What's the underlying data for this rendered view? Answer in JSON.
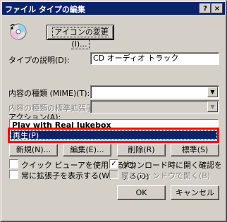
{
  "window": {
    "title": "ファイル タイプの編集",
    "help_label": "?",
    "close_label": "×"
  },
  "icon_button": {
    "label": "アイコンの変更(I)..."
  },
  "description": {
    "label": "タイプの説明(D):",
    "value": "CD オーディオ トラック"
  },
  "content_type": {
    "label": "内容の種類 (MIME)(T):",
    "value": ""
  },
  "default_extension": {
    "label": "内容の種類の標準拡張子(X):",
    "value": ""
  },
  "actions": {
    "label": "アクション(A):",
    "items": [
      "Play with Real Jukebox",
      "再生(P)"
    ]
  },
  "buttons": {
    "new": "新規(N)...",
    "edit": "編集(E)...",
    "remove": "削除(R)",
    "default": "標準(S)",
    "ok": "OK",
    "cancel": "キャンセル"
  },
  "options": {
    "quick_view": {
      "label": "クイック ビューアを使用する(Q)",
      "checked": false
    },
    "confirm_open": {
      "label": "ダウンロード時に開く確認をする(O)",
      "checked": true
    },
    "always_show_ext": {
      "label": "常に拡張子を表示する(W)",
      "checked": false
    },
    "browse_same_window": {
      "label": "同じウィンドウで開く(B)",
      "checked": false
    }
  },
  "colors": {
    "titlebar": "#0a246a",
    "selection": "#0a246a",
    "highlight_box": "#ff0000",
    "face": "#d4d0c8"
  }
}
